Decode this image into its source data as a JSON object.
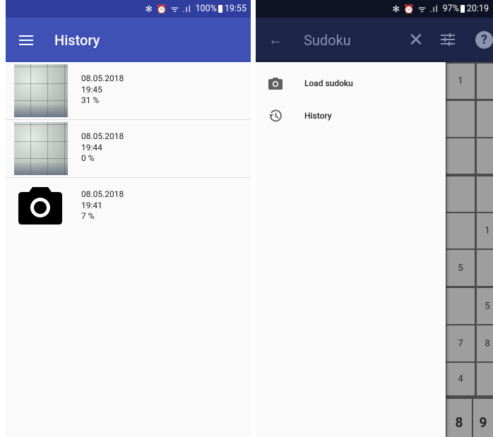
{
  "left_screen": {
    "status": {
      "battery": "100%",
      "time": "19:55"
    },
    "appbar": {
      "title": "History"
    },
    "history": [
      {
        "thumbnail": "sudoku-photo",
        "date": "08.05.2018",
        "time": "19:45",
        "progress": "31 %"
      },
      {
        "thumbnail": "sudoku-photo",
        "date": "08.05.2018",
        "time": "19:44",
        "progress": "0 %"
      },
      {
        "thumbnail": "camera-icon",
        "date": "08.05.2018",
        "time": "19:41",
        "progress": "7 %"
      }
    ]
  },
  "right_screen": {
    "status": {
      "battery": "97%",
      "time": "20:19"
    },
    "appbar": {
      "title": "Sudoku"
    },
    "drawer": {
      "items": [
        {
          "icon": "camera-icon",
          "label": "Load sudoku"
        },
        {
          "icon": "history-icon",
          "label": "History"
        }
      ]
    },
    "grid": {
      "col1": [
        "1",
        "",
        "",
        "",
        "",
        "5",
        "",
        "7",
        "4"
      ],
      "col2": [
        "",
        "",
        "",
        "",
        "1",
        "",
        "5",
        "8",
        ""
      ]
    },
    "keypad": [
      "8",
      "9"
    ]
  },
  "colors": {
    "left_appbar": "#3f51b5",
    "left_statusbar": "#303f9f",
    "right_appbar_dimmed": "#1d2548",
    "grid_cell": "#9e9e9e"
  }
}
